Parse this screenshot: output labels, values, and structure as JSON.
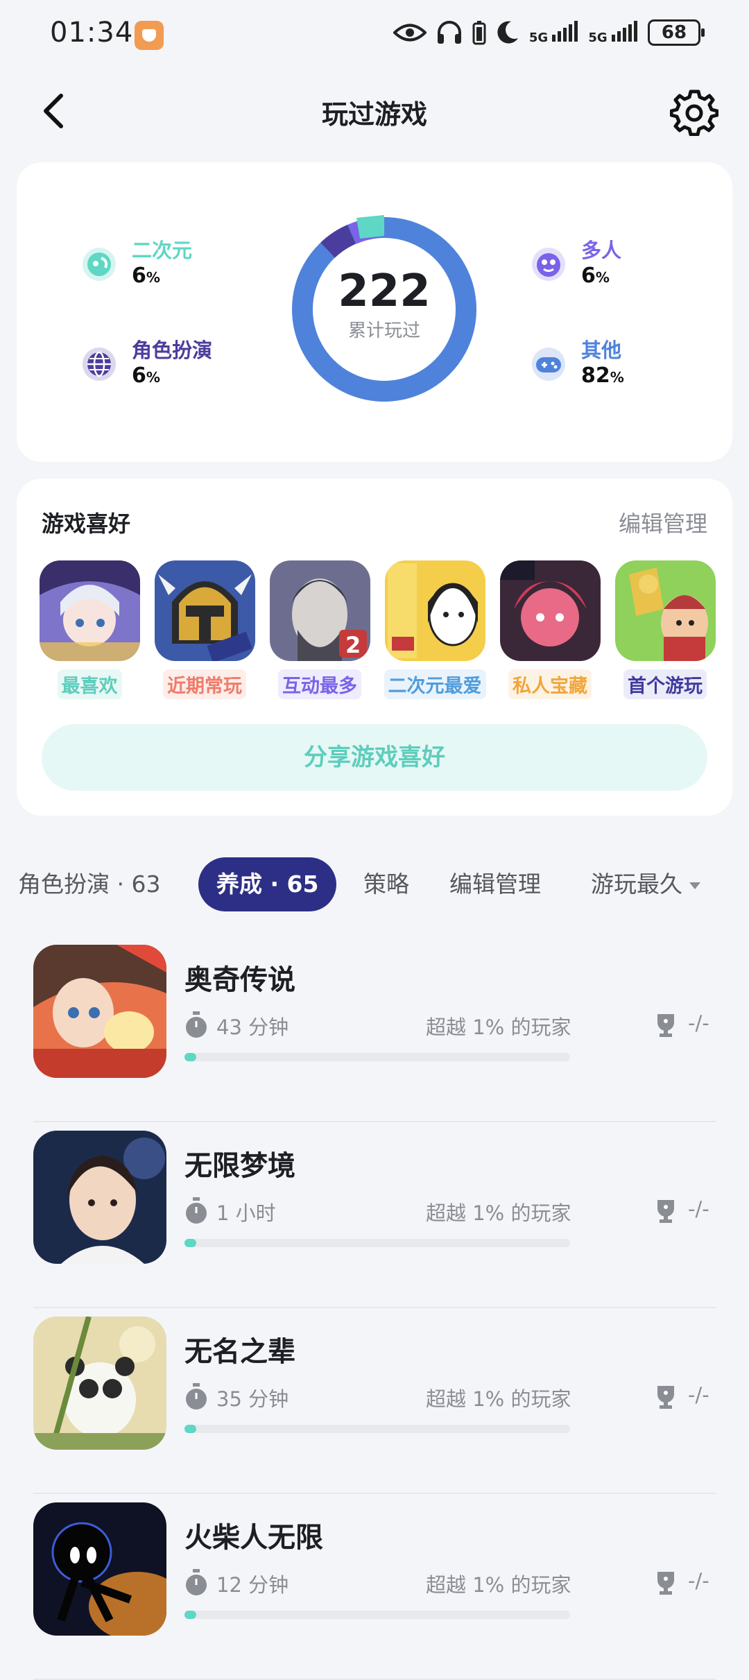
{
  "status_bar": {
    "time": "01:34",
    "network_1": "5G",
    "network_2": "5G",
    "battery": "68"
  },
  "header": {
    "title": "玩过游戏"
  },
  "stats": {
    "total": "222",
    "total_label": "累计玩过",
    "categories": [
      {
        "name": "二次元",
        "percent": "6",
        "color": "#5ed7c4",
        "icon": "anime-icon"
      },
      {
        "name": "角色扮演",
        "percent": "6",
        "color": "#4b3d9e",
        "icon": "globe-icon"
      },
      {
        "name": "多人",
        "percent": "6",
        "color": "#7a63e8",
        "icon": "multiplayer-icon"
      },
      {
        "name": "其他",
        "percent": "82",
        "color": "#4f82db",
        "icon": "gamepad-icon"
      }
    ],
    "percent_unit": "%"
  },
  "preferences": {
    "title": "游戏喜好",
    "edit_label": "编辑管理",
    "games": [
      {
        "tag": "最喜欢",
        "tag_color": "#5ecdbd",
        "tag_bg": "#e8f8f5"
      },
      {
        "tag": "近期常玩",
        "tag_color": "#ef7b6a",
        "tag_bg": "#fdeeea"
      },
      {
        "tag": "互动最多",
        "tag_color": "#7a63e8",
        "tag_bg": "#efecfd"
      },
      {
        "tag": "二次元最爱",
        "tag_color": "#4f9ddb",
        "tag_bg": "#eaf3fc"
      },
      {
        "tag": "私人宝藏",
        "tag_color": "#f2a53d",
        "tag_bg": "#fdf3e4"
      },
      {
        "tag": "首个游玩",
        "tag_color": "#3e3a9e",
        "tag_bg": "#ecebf8"
      }
    ],
    "share_label": "分享游戏喜好"
  },
  "filters": {
    "tabs": [
      {
        "label": "角色扮演 · 63"
      },
      {
        "label": "养成 · 65"
      },
      {
        "label": "策略"
      }
    ],
    "edit_label": "编辑管理",
    "sort_label": "游玩最久"
  },
  "games": [
    {
      "title": "奥奇传说",
      "playtime": "43 分钟",
      "beat": "超越 1% 的玩家",
      "rank": "-/-",
      "progress": 0.03
    },
    {
      "title": "无限梦境",
      "playtime": "1 小时",
      "beat": "超越 1% 的玩家",
      "rank": "-/-",
      "progress": 0.03
    },
    {
      "title": "无名之辈",
      "playtime": "35 分钟",
      "beat": "超越 1% 的玩家",
      "rank": "-/-",
      "progress": 0.03
    },
    {
      "title": "火柴人无限",
      "playtime": "12 分钟",
      "beat": "超越 1% 的玩家",
      "rank": "-/-",
      "progress": 0.03
    }
  ]
}
